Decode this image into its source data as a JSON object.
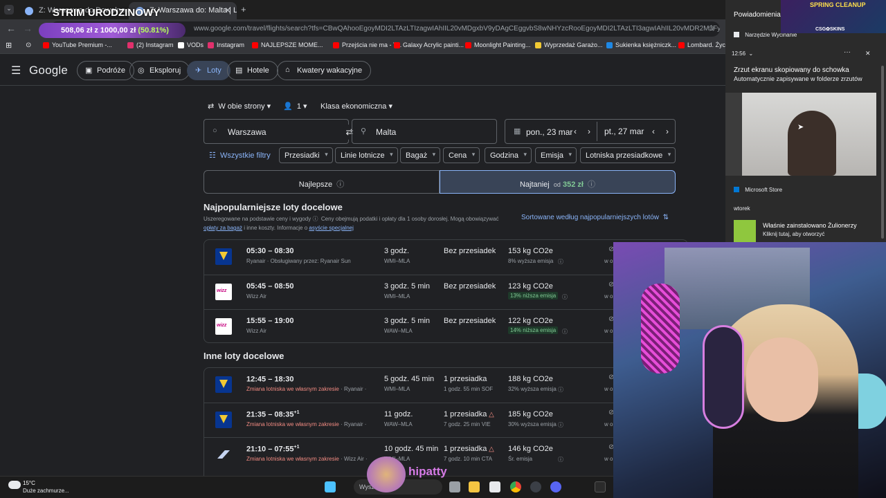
{
  "browser": {
    "tabs": [
      {
        "label": "Z: Warszawa do Dowolne miej"
      },
      {
        "label": "Z: Warszawa do: Malta | Loty G"
      }
    ],
    "new_tab": "+",
    "url": "www.google.com/travel/flights/search?tfs=CBwQAhooEgoyMDI2LTAzLTIzagwIAhIIL20vMDgxbV9yDAgCEggvbS8wNHYzcRooEgoyMDI2LTAzLTI3agwIAhIIL20vMDR2M3FyDAgCEggvbS8wODFtX0ABSAFwAYIBCwj__________",
    "bookmarks": [
      {
        "label": "YouTube Premium -...",
        "color": "#ff0000"
      },
      {
        "label": "(2) Instagram",
        "color": "#e1306c"
      },
      {
        "label": "VODs",
        "color": "#ffffff"
      },
      {
        "label": "Instagram",
        "color": "#e1306c"
      },
      {
        "label": "NAJLEPSZE MOME...",
        "color": "#ff0000"
      },
      {
        "label": "Przejścia nie ma - Y...",
        "color": "#ff0000"
      },
      {
        "label": "Galaxy Acrylic painti...",
        "color": "#ff0000"
      },
      {
        "label": "Moonlight Painting...",
        "color": "#ff0000"
      },
      {
        "label": "Wyprzedaż Garażo...",
        "color": "#f1c933"
      },
      {
        "label": "Sukienka księżniczk...",
        "color": "#1e88e5"
      },
      {
        "label": "Lombard. Życie",
        "color": "#ff0000"
      }
    ]
  },
  "overlay": {
    "stream_title": "STRIM URODZINOWY",
    "goal_current": "508,06 zł",
    "goal_sep": "z",
    "goal_total": "1000,00 zł",
    "goal_pct": "(50.81%)",
    "sponsor_top": "SPRING CLEANUP",
    "sponsor_bottom": "CSG✿SKINS",
    "streamer_name": "hipatty"
  },
  "google": {
    "logo": "Google",
    "nav": [
      {
        "label": "Podróże",
        "icon": "suitcase-icon"
      },
      {
        "label": "Eksploruj",
        "icon": "explore-icon"
      },
      {
        "label": "Loty",
        "icon": "plane-icon"
      },
      {
        "label": "Hotele",
        "icon": "hotel-icon"
      },
      {
        "label": "Kwatery wakacyjne",
        "icon": "house-icon"
      }
    ],
    "trip_type": "W obie strony",
    "passengers": "1",
    "cabin": "Klasa ekonomiczna",
    "origin": "Warszawa",
    "destination": "Malta",
    "depart_date": "pon., 23 mar",
    "return_date": "pt., 27 mar",
    "all_filters": "Wszystkie filtry",
    "filters": [
      "Przesiadki",
      "Linie lotnicze",
      "Bagaż",
      "Cena",
      "Godzina",
      "Emisja",
      "Lotniska przesiadkowe"
    ],
    "sort_best": "Najlepsze",
    "sort_cheapest": "Najtaniej",
    "sort_cheapest_from": "od",
    "sort_cheapest_price": "352 zł",
    "popular_title": "Najpopularniejsze loty docelowe",
    "note_1": "Uszeregowane na podstawie ceny i wygody",
    "note_2": "Ceny obejmują podatki i opłaty dla 1 osoby dorosłej. Mogą obowiązywać",
    "note_link1": "opłaty za bagaż",
    "note_3": "i inne koszty. Informacje o",
    "note_link2": "asyście specjalnej",
    "sort_link": "Sortowane według najpopularniejszych lotów",
    "other_title": "Inne loty docelowe",
    "row_right": "w o",
    "popular_flights": [
      {
        "airline": "ryanair",
        "time": "05:30 – 08:30",
        "sub": "Ryanair · Obsługiwany przez: Ryanair Sun",
        "duration": "3 godz.",
        "route": "WMI–MLA",
        "stops": "Bez przesiadek",
        "stops_sub": "",
        "emission": "153 kg CO2e",
        "emission_note": "8% wyższa emisja",
        "lower": false
      },
      {
        "airline": "wizz",
        "time": "05:45 – 08:50",
        "sub": "Wizz Air",
        "duration": "3 godz. 5 min",
        "route": "WMI–MLA",
        "stops": "Bez przesiadek",
        "stops_sub": "",
        "emission": "123 kg CO2e",
        "emission_note": "13% niższa emisja",
        "lower": true
      },
      {
        "airline": "wizz",
        "time": "15:55 – 19:00",
        "sub": "Wizz Air",
        "duration": "3 godz. 5 min",
        "route": "WAW–MLA",
        "stops": "Bez przesiadek",
        "stops_sub": "",
        "emission": "122 kg CO2e",
        "emission_note": "14% niższa emisja",
        "lower": true
      }
    ],
    "other_flights": [
      {
        "airline": "ryanair",
        "time": "12:45 – 18:30",
        "sup": "",
        "warn": "Zmiana lotniska we własnym zakresie",
        "sub": "· Ryanair ·",
        "duration": "5 godz. 45 min",
        "route": "WMI–MLA",
        "stops": "1 przesiadka",
        "tri": false,
        "stops_sub": "1 godz. 55 min SOF",
        "emission": "188 kg CO2e",
        "emission_note": "32% wyższa emisja"
      },
      {
        "airline": "ryanair",
        "time": "21:35 – 08:35",
        "sup": "+1",
        "warn": "Zmiana lotniska we własnym zakresie",
        "sub": "· Ryanair ·",
        "duration": "11 godz.",
        "route": "WAW–MLA",
        "stops": "1 przesiadka",
        "tri": true,
        "stops_sub": "7 godz. 25 min VIE",
        "emission": "185 kg CO2e",
        "emission_note": "30% wyższa emisja"
      },
      {
        "airline": "other",
        "time": "21:10 – 07:55",
        "sup": "+1",
        "warn": "Zmiana lotniska we własnym zakresie",
        "sub": "· Wizz Air ·",
        "duration": "10 godz. 45 min",
        "route": "WMI–MLA",
        "stops": "1 przesiadka",
        "tri": true,
        "stops_sub": "7 godz. 10 min CTA",
        "emission": "146 kg CO2e",
        "emission_note": "Śr. emisja"
      }
    ]
  },
  "notifications": {
    "title": "Powiadomienia",
    "snip_app": "Narzędzie Wycinanie",
    "time": "12:56",
    "copied_title": "Zrzut ekranu skopiowany do schowka",
    "copied_body": "Automatycznie zapisywane w folderze zrzutów",
    "store_app": "Microsoft Store",
    "day": "wtorek",
    "install_title": "Właśnie zainstalowano Żulionerzy",
    "install_body": "Kliknij tutaj, aby otworzyć"
  },
  "taskbar": {
    "temp": "15°C",
    "weather": "Duże zachmurze...",
    "search": "Wyszukaj"
  }
}
